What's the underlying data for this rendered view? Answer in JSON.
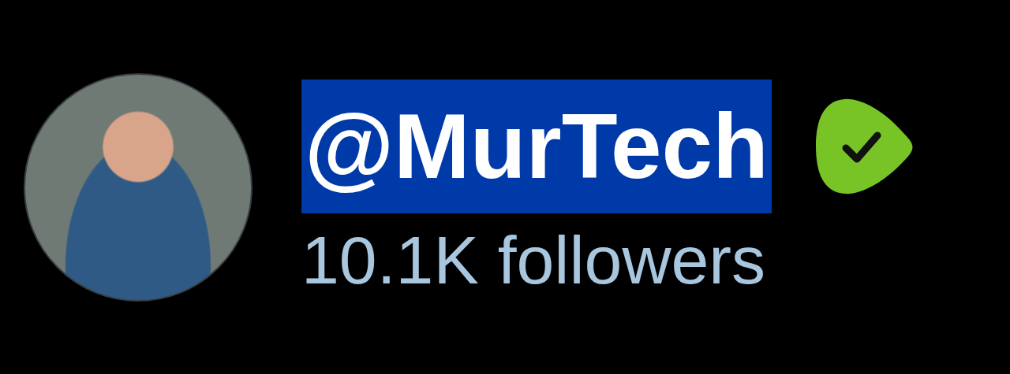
{
  "profile": {
    "avatar": "photo",
    "handle": {
      "text": "@MurTech",
      "selected": true
    },
    "verified": true,
    "followers": "10.1K followers"
  }
}
